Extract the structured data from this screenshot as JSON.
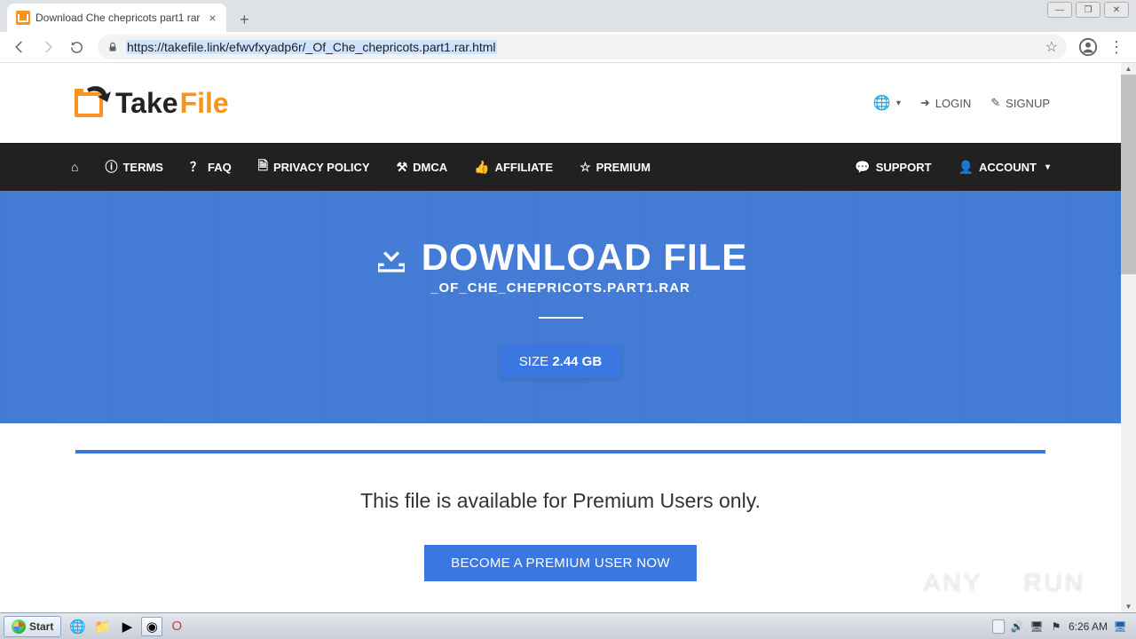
{
  "browser": {
    "tab_title": "Download Che chepricots part1 rar",
    "url": "https://takefile.link/efwvfxyadp6r/_Of_Che_chepricots.part1.rar.html"
  },
  "header": {
    "logo_part1": "Take",
    "logo_part2": "File",
    "login": "LOGIN",
    "signup": "SIGNUP"
  },
  "nav": {
    "terms": "TERMS",
    "faq": "FAQ",
    "privacy": "PRIVACY POLICY",
    "dmca": "DMCA",
    "affiliate": "AFFILIATE",
    "premium": "PREMIUM",
    "support": "SUPPORT",
    "account": "ACCOUNT"
  },
  "hero": {
    "title": "DOWNLOAD FILE",
    "filename": "_OF_CHE_CHEPRICOTS.PART1.RAR",
    "size_label": "SIZE",
    "size_value": "2.44 GB"
  },
  "content": {
    "premium_message": "This file is available for Premium Users only.",
    "become_premium": "BECOME A PREMIUM USER NOW"
  },
  "watermark": {
    "part1": "ANY",
    "part2": "RUN"
  },
  "taskbar": {
    "start": "Start",
    "clock": "6:26 AM"
  }
}
